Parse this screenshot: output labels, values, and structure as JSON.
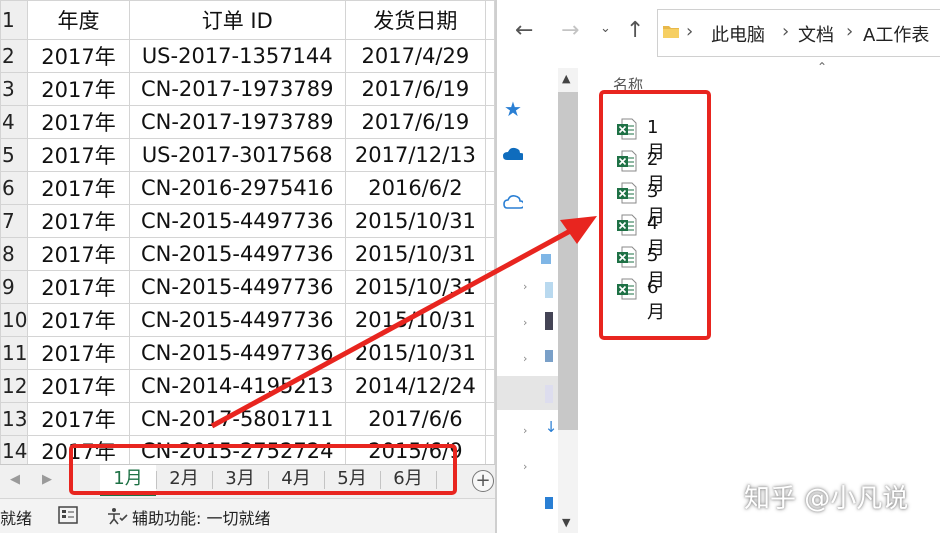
{
  "spreadsheet": {
    "columns": [
      "年度",
      "订单 ID",
      "发货日期"
    ],
    "rows": [
      {
        "num": "2",
        "year": "2017年",
        "order_id": "US-2017-1357144",
        "date": "2017/4/29"
      },
      {
        "num": "3",
        "year": "2017年",
        "order_id": "CN-2017-1973789",
        "date": "2017/6/19"
      },
      {
        "num": "4",
        "year": "2017年",
        "order_id": "CN-2017-1973789",
        "date": "2017/6/19"
      },
      {
        "num": "5",
        "year": "2017年",
        "order_id": "US-2017-3017568",
        "date": "2017/12/13"
      },
      {
        "num": "6",
        "year": "2017年",
        "order_id": "CN-2016-2975416",
        "date": "2016/6/2"
      },
      {
        "num": "7",
        "year": "2017年",
        "order_id": "CN-2015-4497736",
        "date": "2015/10/31"
      },
      {
        "num": "8",
        "year": "2017年",
        "order_id": "CN-2015-4497736",
        "date": "2015/10/31"
      },
      {
        "num": "9",
        "year": "2017年",
        "order_id": "CN-2015-4497736",
        "date": "2015/10/31"
      },
      {
        "num": "10",
        "year": "2017年",
        "order_id": "CN-2015-4497736",
        "date": "2015/10/31"
      },
      {
        "num": "11",
        "year": "2017年",
        "order_id": "CN-2015-4497736",
        "date": "2015/10/31"
      },
      {
        "num": "12",
        "year": "2017年",
        "order_id": "CN-2014-4195213",
        "date": "2014/12/24"
      },
      {
        "num": "13",
        "year": "2017年",
        "order_id": "CN-2017-5801711",
        "date": "2017/6/6"
      },
      {
        "num": "14",
        "year": "2017年",
        "order_id": "CN-2015-2752724",
        "date": "2015/6/9"
      }
    ],
    "header_row_num": "1",
    "sheet_tabs": [
      "1月",
      "2月",
      "3月",
      "4月",
      "5月",
      "6月"
    ],
    "active_tab": "1月",
    "add_sheet_symbol": "+",
    "status": {
      "ready": "就绪",
      "accessibility": "辅助功能: 一切就绪"
    }
  },
  "explorer": {
    "breadcrumbs": [
      "此电脑",
      "文档",
      "A工作表"
    ],
    "column_header": "名称",
    "files": [
      "1月",
      "2月",
      "3月",
      "4月",
      "5月",
      "6月"
    ]
  },
  "watermark": "知乎 @小凡说",
  "colors": {
    "highlight_red": "#e8251f",
    "excel_green": "#1e7145",
    "onedrive_blue": "#0f6cbd"
  },
  "icons": [
    "back-arrow-icon",
    "forward-arrow-icon",
    "up-arrow-icon",
    "folder-icon",
    "quick-access-star-icon",
    "onedrive-cloud-icon",
    "excel-file-icon"
  ]
}
